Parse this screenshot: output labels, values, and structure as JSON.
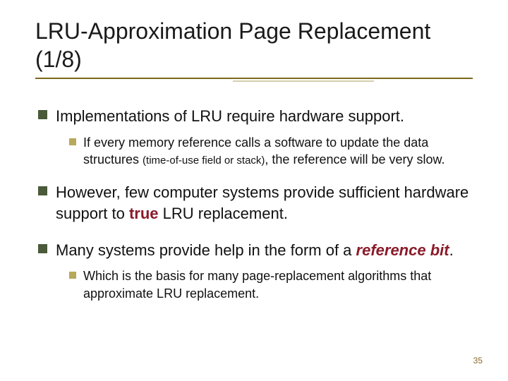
{
  "title": "LRU-Approximation Page Replacement (1/8)",
  "bullets": {
    "b1": "Implementations of LRU require hardware support.",
    "b1a_pre": "If every memory reference calls a software to update the data structures ",
    "b1a_small": "(time-of-use field or stack)",
    "b1a_post": ", the reference will be very slow.",
    "b2_pre": "However, few computer systems provide sufficient hardware support to ",
    "b2_em": "true",
    "b2_post": " LRU replacement.",
    "b3_pre": "Many systems provide help in the form of a ",
    "b3_em": "reference bit",
    "b3_post": ".",
    "b3a": "Which is the basis for many page-replacement algorithms that approximate LRU replacement."
  },
  "page": "35"
}
